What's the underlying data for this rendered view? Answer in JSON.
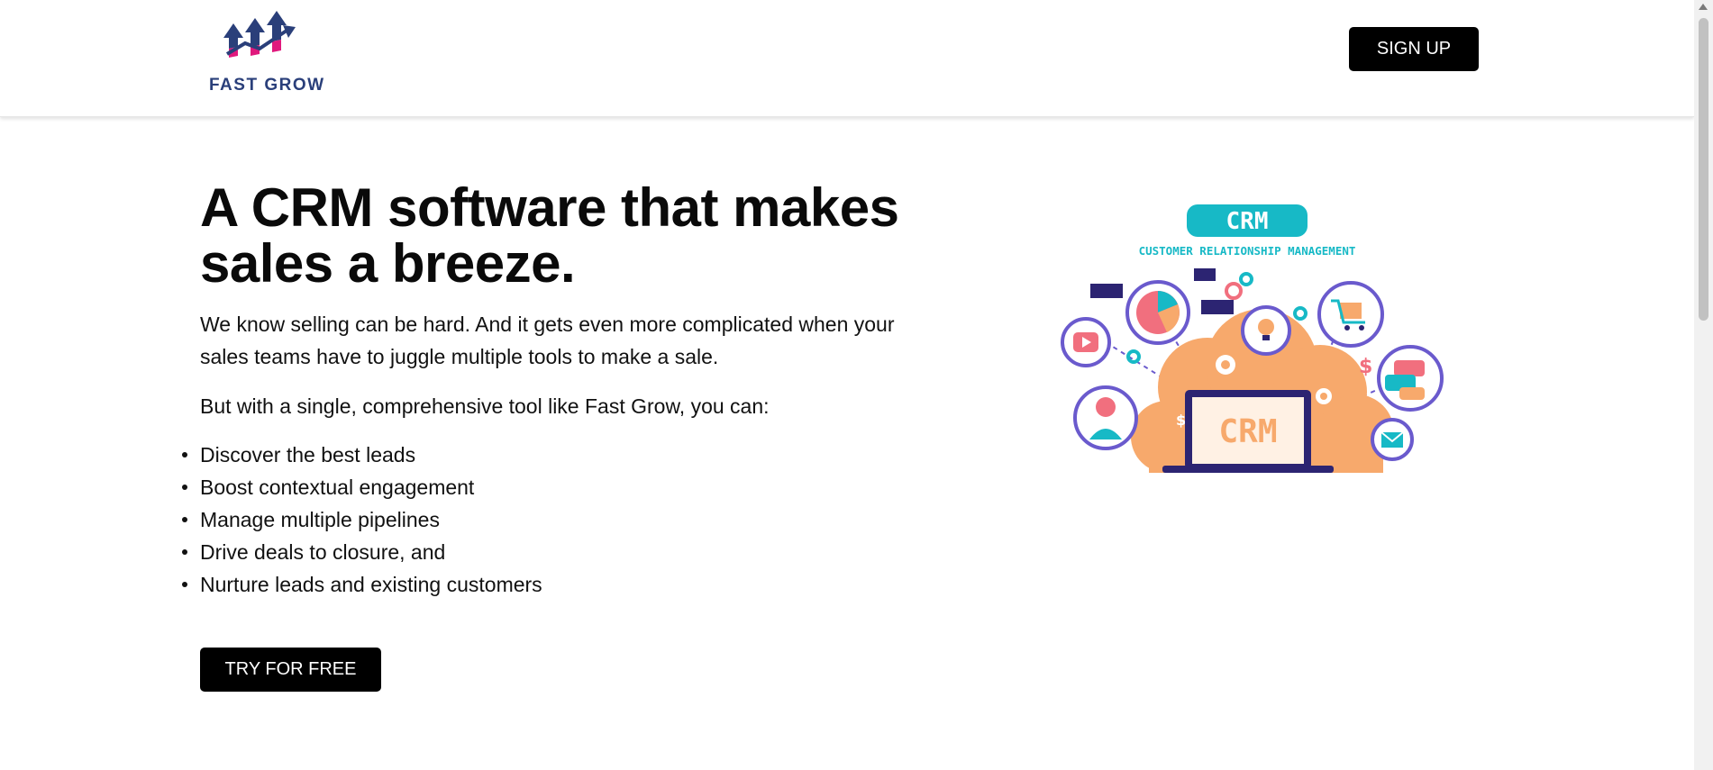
{
  "header": {
    "logo_text": "FAST GROW",
    "signup_label": "SIGN UP"
  },
  "hero": {
    "title": "A CRM software that makes sales a breeze.",
    "paragraph_1": "We know selling can be hard. And it gets even more complicated when your sales teams have to juggle multiple tools to make a sale.",
    "paragraph_2": "But with a single, comprehensive tool like Fast Grow, you can:",
    "bullets": [
      "Discover the best leads",
      "Boost contextual engagement",
      "Manage multiple pipelines",
      "Drive deals to closure, and",
      "Nurture leads and existing customers"
    ],
    "cta_label": "TRY FOR FREE"
  },
  "illustration": {
    "badge": "CRM",
    "subtitle": "CUSTOMER RELATIONSHIP MANAGEMENT",
    "screen_text": "CRM"
  },
  "colors": {
    "brand_navy": "#2a3f7a",
    "brand_pink": "#e0197d",
    "teal": "#17b9c6",
    "orange": "#f7a96c",
    "purple": "#6a5acd",
    "button_bg": "#000000"
  }
}
